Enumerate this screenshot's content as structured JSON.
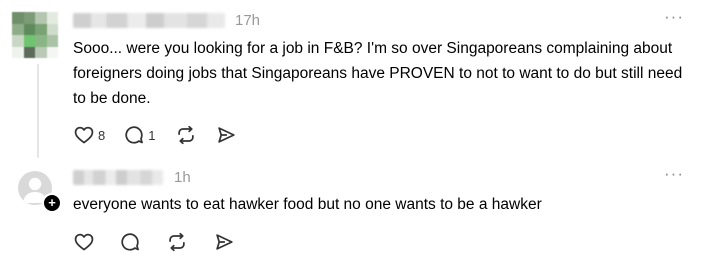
{
  "posts": [
    {
      "time": "17h",
      "more": "···",
      "text": "Sooo... were you looking for a job in F&B? I'm so over Singaporeans complaining about foreigners doing jobs that Singaporeans have PROVEN to not to want to do but still need to be done.",
      "likes": "8",
      "replies": "1",
      "icons": [
        "heart-icon",
        "comment-icon",
        "repost-icon",
        "share-icon"
      ]
    },
    {
      "time": "1h",
      "more": "···",
      "text": "everyone wants to eat hawker food but no one wants to be a hawker",
      "badge": "+",
      "icons": [
        "heart-icon",
        "comment-icon",
        "repost-icon",
        "share-icon"
      ]
    }
  ],
  "colors": {
    "text": "#000000",
    "muted": "#999999",
    "icon": "#333333",
    "thread_line": "#e5e5e5"
  }
}
